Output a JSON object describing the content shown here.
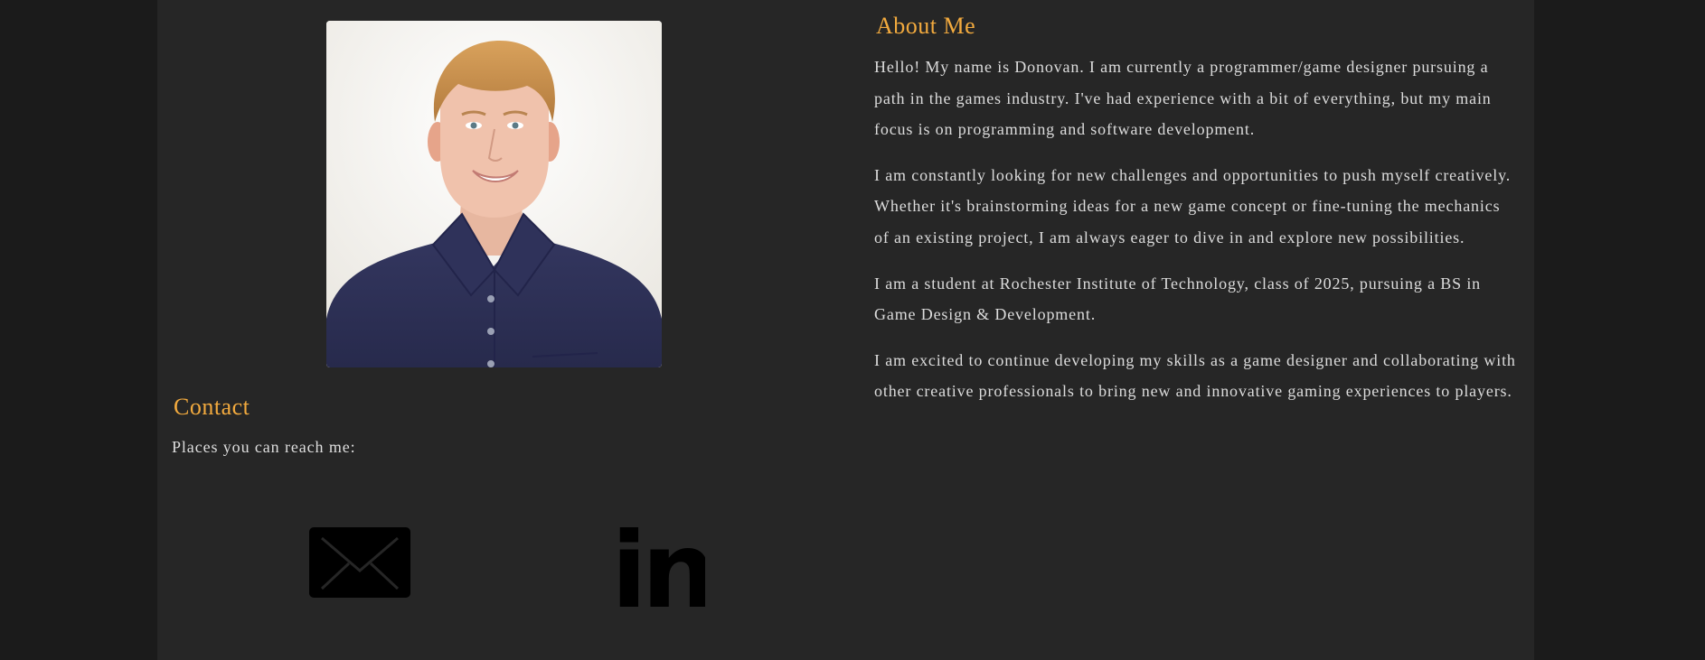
{
  "contact": {
    "heading": "Contact",
    "subtext": "Places you can reach me:",
    "icons": [
      "mail-icon",
      "linkedin-icon"
    ],
    "linkedin_glyph": "in"
  },
  "about": {
    "heading": "About Me",
    "paragraphs": [
      "Hello! My name is Donovan. I am currently a programmer/game designer pursuing a path in the games industry. I've had experience with a bit of everything, but my main focus is on programming and software development.",
      "I am constantly looking for new challenges and opportunities to push myself creatively. Whether it's brainstorming ideas for a new game concept or fine-tuning the mechanics of an existing project, I am always eager to dive in and explore new possibilities.",
      "I am a student at Rochester Institute of Technology, class of 2025, pursuing a BS in Game Design & Development.",
      "I am excited to continue developing my skills as a game designer and collaborating with other creative professionals to bring new and innovative gaming experiences to players."
    ]
  },
  "colors": {
    "background": "#1b1b1b",
    "panel": "#262626",
    "accent": "#f2aa3e",
    "text": "#dcdcdc"
  }
}
